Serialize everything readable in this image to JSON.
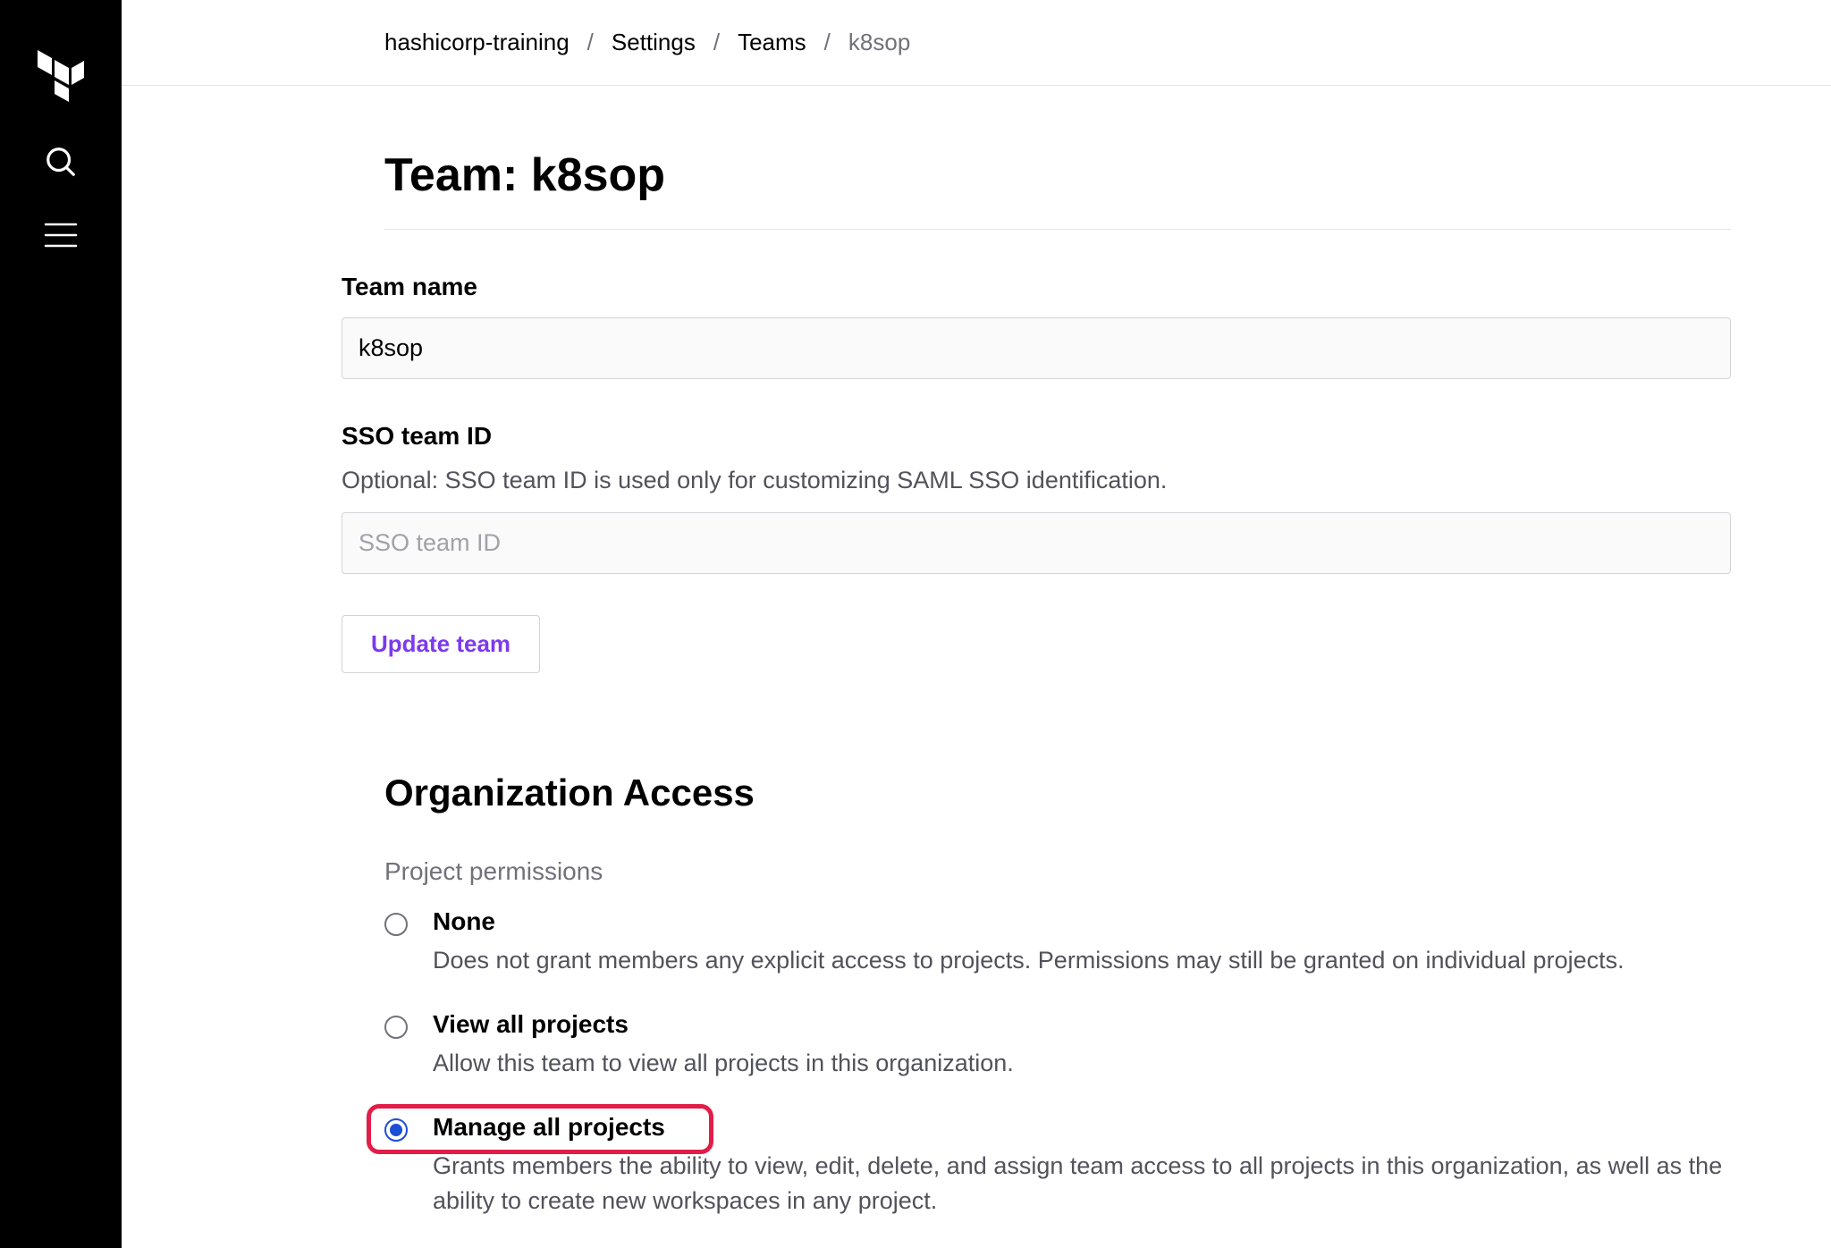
{
  "breadcrumb": {
    "items": [
      {
        "label": "hashicorp-training"
      },
      {
        "label": "Settings"
      },
      {
        "label": "Teams"
      },
      {
        "label": "k8sop",
        "current": true
      }
    ],
    "separator": "/"
  },
  "page": {
    "title": "Team: k8sop"
  },
  "team_name": {
    "label": "Team name",
    "value": "k8sop"
  },
  "sso_team_id": {
    "label": "SSO team ID",
    "help": "Optional: SSO team ID is used only for customizing SAML SSO identification.",
    "placeholder": "SSO team ID",
    "value": ""
  },
  "buttons": {
    "update_team": "Update team"
  },
  "org_access": {
    "section_title": "Organization Access",
    "project_permissions": {
      "subheading": "Project permissions",
      "options": [
        {
          "id": "none",
          "title": "None",
          "description": "Does not grant members any explicit access to projects. Permissions may still be granted on individual projects.",
          "selected": false
        },
        {
          "id": "view-all",
          "title": "View all projects",
          "description": "Allow this team to view all projects in this organization.",
          "selected": false
        },
        {
          "id": "manage-all",
          "title": "Manage all projects",
          "description": "Grants members the ability to view, edit, delete, and assign team access to all projects in this organization, as well as the ability to create new workspaces in any project.",
          "selected": true,
          "highlighted": true
        }
      ]
    }
  }
}
